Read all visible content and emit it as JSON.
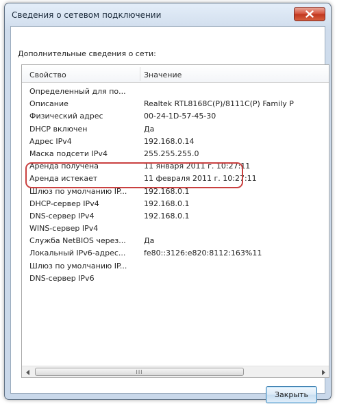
{
  "window": {
    "title": "Сведения о сетевом подключении",
    "close_icon": "close-x-icon"
  },
  "section_label": "Дополнительные сведения о сети:",
  "columns": {
    "property": "Свойство",
    "value": "Значение"
  },
  "rows": [
    {
      "property": "Определенный для по...",
      "value": ""
    },
    {
      "property": "Описание",
      "value": "Realtek RTL8168C(P)/8111C(P) Family P"
    },
    {
      "property": "Физический адрес",
      "value": "00-24-1D-57-45-30"
    },
    {
      "property": "DHCP включен",
      "value": "Да"
    },
    {
      "property": "Адрес IPv4",
      "value": "192.168.0.14"
    },
    {
      "property": "Маска подсети IPv4",
      "value": "255.255.255.0"
    },
    {
      "property": "Аренда получена",
      "value": "11 января 2011 г. 10:27:11"
    },
    {
      "property": "Аренда истекает",
      "value": "11 февраля 2011 г. 10:27:11"
    },
    {
      "property": "Шлюз по умолчанию IP...",
      "value": "192.168.0.1"
    },
    {
      "property": "DHCP-сервер IPv4",
      "value": "192.168.0.1"
    },
    {
      "property": "DNS-сервер IPv4",
      "value": "192.168.0.1"
    },
    {
      "property": "WINS-сервер IPv4",
      "value": ""
    },
    {
      "property": "Служба NetBIOS через...",
      "value": "Да"
    },
    {
      "property": "Локальный IPv6-адрес...",
      "value": "fe80::3126:e820:8112:163%11"
    },
    {
      "property": "Шлюз по умолчанию IP...",
      "value": ""
    },
    {
      "property": "DNS-сервер IPv6",
      "value": ""
    }
  ],
  "scrollbar": {
    "left_icon": "scroll-left-arrow-icon",
    "right_icon": "scroll-right-arrow-icon",
    "grip": "III"
  },
  "buttons": {
    "close_label": "Закрыть"
  },
  "colors": {
    "highlight": "#c9403f",
    "close_button": "#c0361f"
  }
}
